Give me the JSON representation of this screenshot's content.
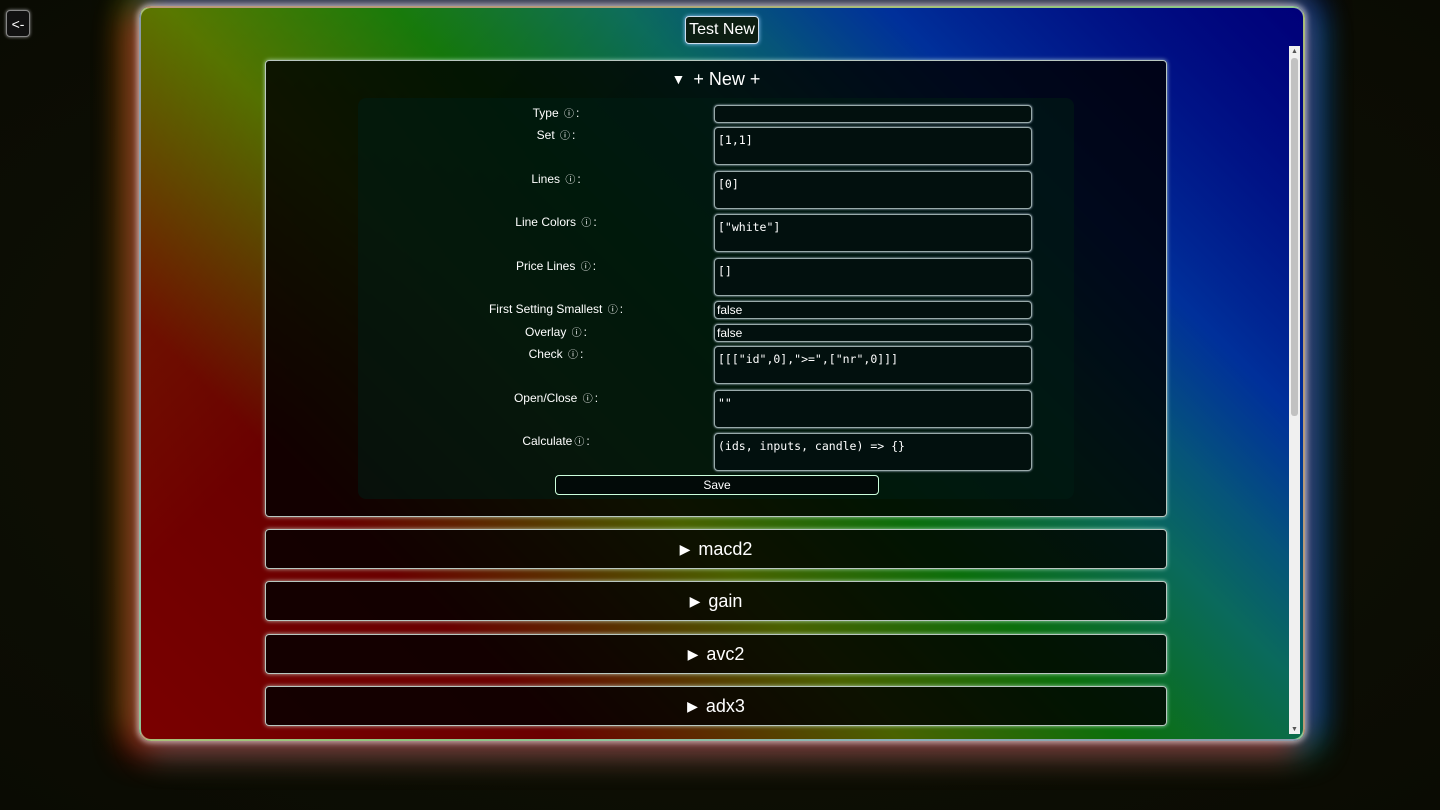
{
  "back_button": "<-",
  "window_title": "Test New",
  "new_section": {
    "summary": "+ New +",
    "fields": [
      {
        "label": "Type",
        "value": "",
        "info": "ⓘ"
      },
      {
        "label": "Set",
        "value": "[1,1]",
        "info": "ⓘ"
      },
      {
        "label": "Lines",
        "value": "[0]",
        "info": "ⓘ"
      },
      {
        "label": "Line Colors",
        "value": "[\"white\"]",
        "info": "ⓘ"
      },
      {
        "label": "Price Lines",
        "value": "[]",
        "info": "ⓘ"
      },
      {
        "label": "First Setting Smallest",
        "value": "false",
        "info": "ⓘ"
      },
      {
        "label": "Overlay",
        "value": "false",
        "info": "ⓘ"
      },
      {
        "label": "Check",
        "value": "[[[\"id\",0],\">=\",[\"nr\",0]]]",
        "info": "ⓘ"
      },
      {
        "label": "Open/Close",
        "value": "\"\"",
        "info": "ⓘ"
      },
      {
        "label": "Calculate",
        "value": "(ids, inputs, candle) => {}",
        "info": "ⓘ"
      }
    ],
    "save_label": "Save"
  },
  "collapsed_sections": [
    "macd2",
    "gain",
    "avc2",
    "adx3"
  ],
  "colon": ":"
}
